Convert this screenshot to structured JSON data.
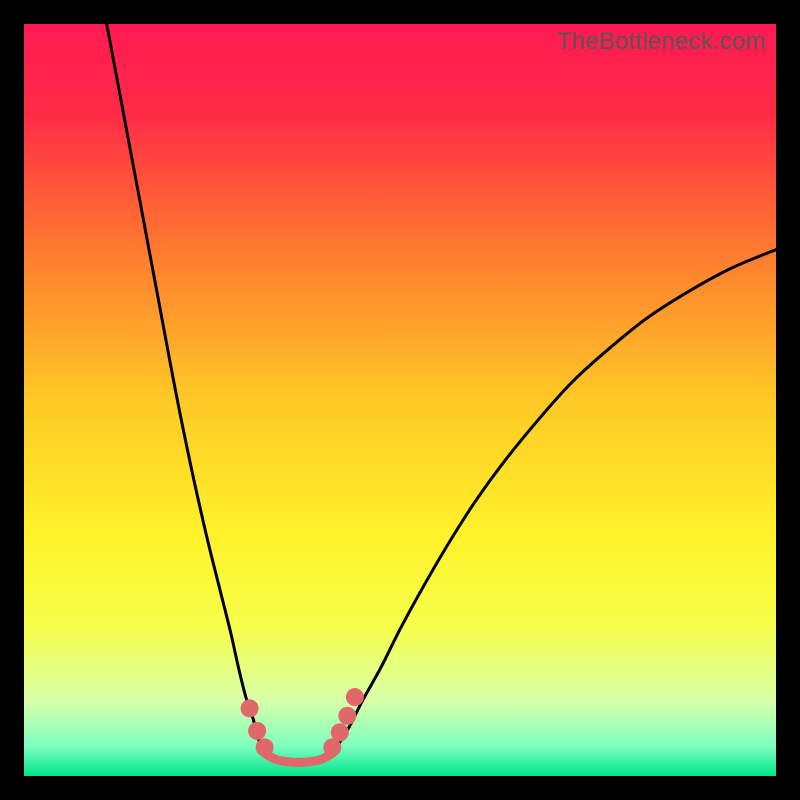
{
  "watermark": "TheBottleneck.com",
  "chart_data": {
    "type": "line",
    "title": "",
    "xlabel": "",
    "ylabel": "",
    "xlim": [
      0,
      100
    ],
    "ylim": [
      0,
      100
    ],
    "grid": false,
    "legend": false,
    "background_gradient": {
      "stops": [
        {
          "offset": 0.0,
          "color": "#ff1a52"
        },
        {
          "offset": 0.12,
          "color": "#ff2b46"
        },
        {
          "offset": 0.3,
          "color": "#ff7a2f"
        },
        {
          "offset": 0.5,
          "color": "#ffc926"
        },
        {
          "offset": 0.68,
          "color": "#fff22a"
        },
        {
          "offset": 0.8,
          "color": "#f6ff4a"
        },
        {
          "offset": 0.9,
          "color": "#d8ffa8"
        },
        {
          "offset": 0.96,
          "color": "#7effc0"
        },
        {
          "offset": 1.0,
          "color": "#00e58a"
        }
      ]
    },
    "series": [
      {
        "name": "left-curve",
        "color": "#000000",
        "x": [
          11.0,
          12.5,
          14.0,
          15.5,
          17.0,
          18.5,
          20.0,
          21.5,
          23.0,
          24.5,
          26.0,
          27.5,
          28.5,
          29.5,
          30.5,
          31.0,
          31.5,
          32.0
        ],
        "y": [
          100.0,
          92.0,
          84.0,
          76.0,
          68.0,
          60.0,
          52.0,
          44.5,
          37.5,
          31.0,
          25.0,
          19.0,
          14.5,
          10.5,
          7.5,
          5.5,
          4.0,
          3.0
        ]
      },
      {
        "name": "right-curve",
        "color": "#000000",
        "x": [
          41.0,
          42.0,
          43.5,
          45.0,
          47.5,
          50.0,
          53.0,
          56.5,
          60.0,
          64.0,
          68.5,
          73.0,
          78.0,
          83.0,
          88.5,
          94.0,
          100.0
        ],
        "y": [
          3.0,
          4.5,
          7.0,
          10.0,
          14.5,
          19.5,
          25.0,
          31.0,
          36.5,
          42.0,
          47.5,
          52.5,
          57.0,
          61.0,
          64.5,
          67.5,
          70.0
        ]
      },
      {
        "name": "valley-floor",
        "color": "#e06868",
        "x": [
          32.0,
          33.5,
          35.0,
          36.5,
          38.0,
          39.5,
          41.0
        ],
        "y": [
          3.0,
          2.2,
          1.9,
          1.8,
          1.9,
          2.2,
          3.0
        ]
      }
    ],
    "markers": [
      {
        "name": "left-dot-1",
        "x": 30.0,
        "y": 9.0,
        "r": 1.2,
        "color": "#e06868"
      },
      {
        "name": "left-dot-2",
        "x": 31.0,
        "y": 6.0,
        "r": 1.2,
        "color": "#e06868"
      },
      {
        "name": "left-dot-3",
        "x": 32.0,
        "y": 3.8,
        "r": 1.2,
        "color": "#e06868"
      },
      {
        "name": "right-dot-1",
        "x": 41.0,
        "y": 3.8,
        "r": 1.2,
        "color": "#e06868"
      },
      {
        "name": "right-dot-2",
        "x": 42.0,
        "y": 5.8,
        "r": 1.2,
        "color": "#e06868"
      },
      {
        "name": "right-dot-3",
        "x": 43.0,
        "y": 8.0,
        "r": 1.2,
        "color": "#e06868"
      },
      {
        "name": "right-dot-4",
        "x": 44.0,
        "y": 10.5,
        "r": 1.2,
        "color": "#e06868"
      }
    ]
  }
}
